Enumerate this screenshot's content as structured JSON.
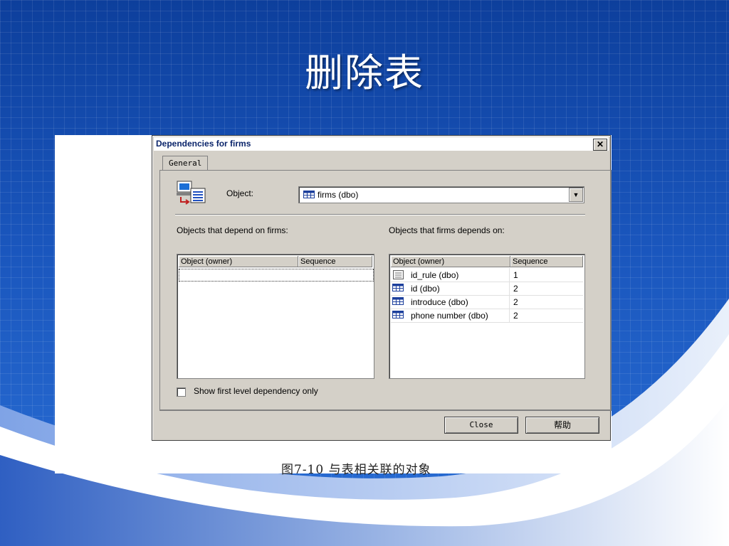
{
  "slide": {
    "title": "删除表",
    "caption": "图7-10  与表相关联的对象",
    "colors": {
      "background": "#1a56bd",
      "accent_light": "#a9c3ee"
    }
  },
  "dialog": {
    "title": "Dependencies for firms",
    "close_glyph": "✕",
    "tab_label": "General",
    "object_label": "Object:",
    "object_value": "firms (dbo)",
    "dropdown_glyph": "▼",
    "left_group_label": "Objects that depend on firms:",
    "right_group_label": "Objects that firms depends on:",
    "list_headers": [
      "Object (owner)",
      "Sequence"
    ],
    "depends_on_items": [
      {
        "name": "id_rule (dbo)",
        "sequence": "1",
        "icon": "rule-icon"
      },
      {
        "name": "id (dbo)",
        "sequence": "2",
        "icon": "table-icon"
      },
      {
        "name": "introduce (dbo)",
        "sequence": "2",
        "icon": "table-icon"
      },
      {
        "name": "phone number (dbo)",
        "sequence": "2",
        "icon": "table-icon"
      }
    ],
    "checkbox_label": "Show first level dependency only",
    "checkbox_checked": false,
    "close_button": "Close",
    "help_button": "帮助"
  }
}
